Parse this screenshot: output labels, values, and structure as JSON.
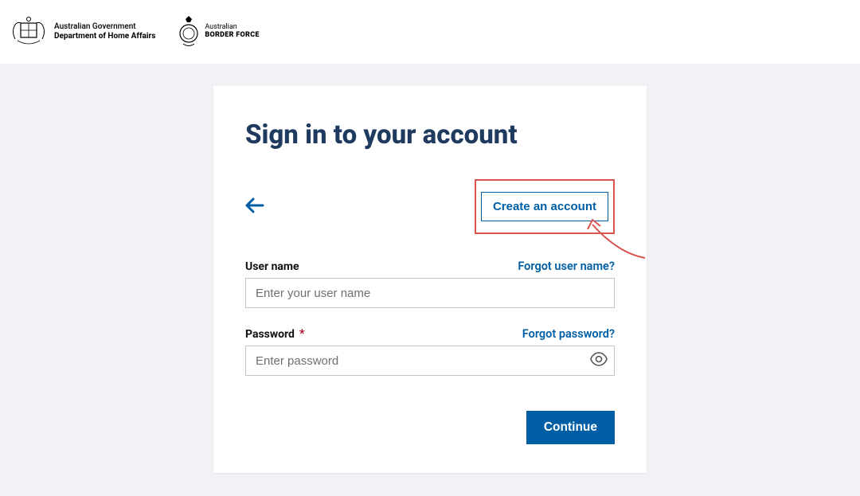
{
  "header": {
    "gov_line1": "Australian Government",
    "gov_line2": "Department of Home Affairs",
    "abf_line1": "Australian",
    "abf_line2": "BORDER FORCE"
  },
  "card": {
    "title": "Sign in to your account",
    "create_account": "Create an account",
    "username_label": "User name",
    "forgot_username": "Forgot user name?",
    "username_placeholder": "Enter your user name",
    "password_label": "Password",
    "required_mark": "*",
    "forgot_password": "Forgot password?",
    "password_placeholder": "Enter password",
    "continue": "Continue"
  }
}
